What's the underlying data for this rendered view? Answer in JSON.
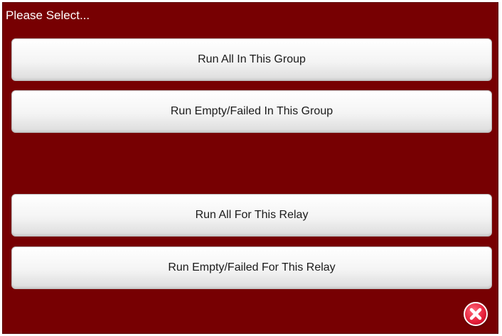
{
  "dialog": {
    "title": "Please Select...",
    "buttons": [
      {
        "label": "Run All In This Group"
      },
      {
        "label": "Run Empty/Failed In This Group"
      },
      {
        "label": "Run All For This Relay"
      },
      {
        "label": "Run Empty/Failed For This Relay"
      }
    ],
    "close_icon": "close-x-icon"
  },
  "colors": {
    "background": "#770002",
    "button_face": "#f4f4f4",
    "close_icon": "#e8233d"
  }
}
